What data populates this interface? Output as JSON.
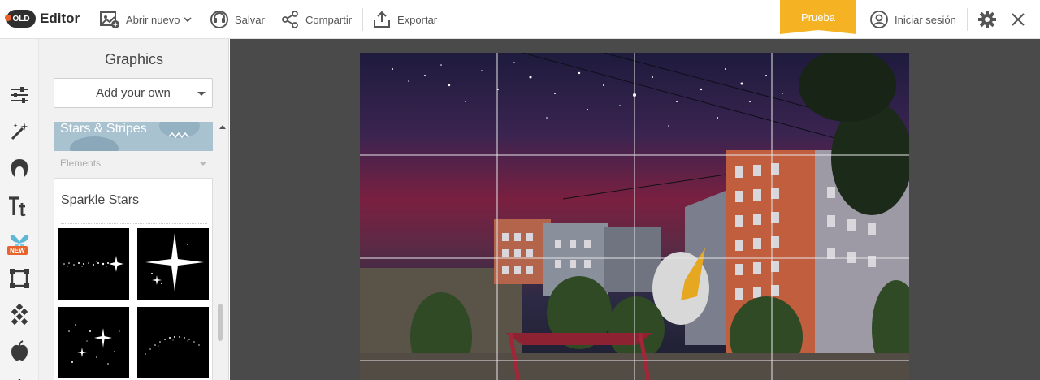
{
  "app": {
    "logo_badge": "OLD",
    "logo_text": "Editor"
  },
  "toolbar": {
    "open_new": "Abrir nuevo",
    "save": "Salvar",
    "share": "Compartir",
    "export": "Exportar",
    "trial": "Prueba",
    "sign_in": "Iniciar sesión"
  },
  "rail": {
    "new_badge": "NEW"
  },
  "panel": {
    "title": "Graphics",
    "add_own": "Add your own",
    "collection": "Stars & Stripes",
    "category": "Elements",
    "section_title": "Sparkle Stars"
  },
  "colors": {
    "accent": "#f5b222",
    "brand": "#e8622c",
    "workspace": "#4a4a4a"
  }
}
